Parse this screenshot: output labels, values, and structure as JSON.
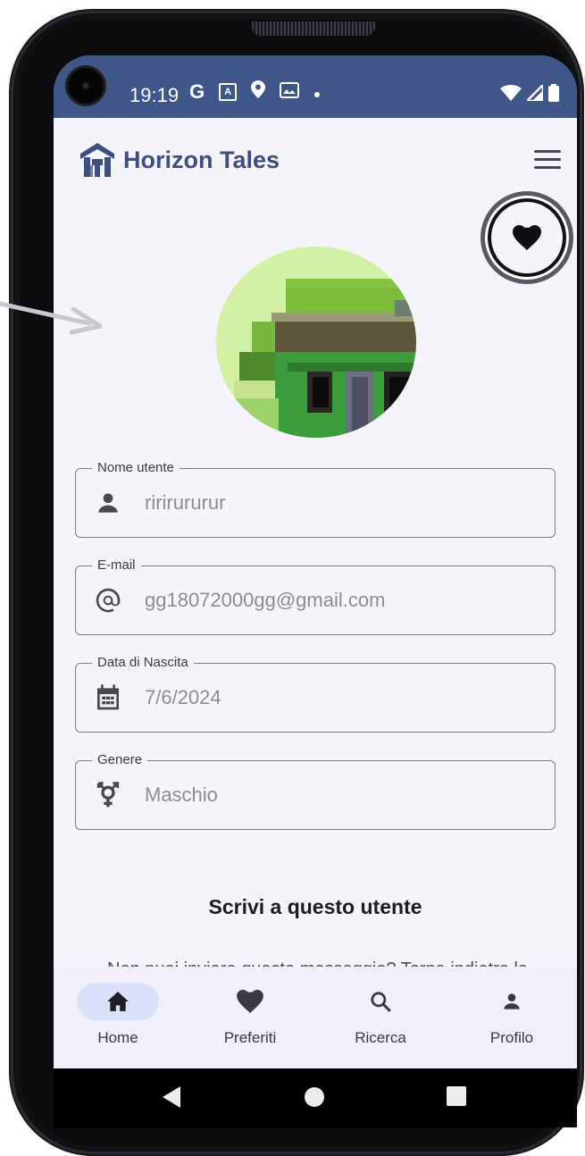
{
  "status_bar": {
    "time": "19:19",
    "icons": [
      "google-g-icon",
      "app-a-icon",
      "location-pin-icon",
      "gallery-icon",
      "dot-icon"
    ],
    "right_icons": [
      "wifi-icon",
      "signal-icon",
      "battery-icon"
    ],
    "color": "#3f5689"
  },
  "app_bar": {
    "title": "Horizon Tales",
    "title_color": "#3d4e80",
    "menu_icon": "hamburger-menu-icon"
  },
  "favorite_button": {
    "icon": "heart-icon"
  },
  "profile": {
    "fields": [
      {
        "label": "Nome utente",
        "value": "ririrururur",
        "icon": "person-icon"
      },
      {
        "label": "E-mail",
        "value": "gg18072000gg@gmail.com",
        "icon": "at-sign-icon"
      },
      {
        "label": "Data di Nascita",
        "value": "7/6/2024",
        "icon": "calendar-icon"
      },
      {
        "label": "Genere",
        "value": "Maschio",
        "icon": "gender-icon"
      }
    ],
    "section_title": "Scrivi a questo utente",
    "peek_text": "Non puoi inviare questo messaggio? Torna indietro la"
  },
  "bottom_nav": {
    "items": [
      {
        "label": "Home",
        "icon": "home-icon",
        "active": true
      },
      {
        "label": "Preferiti",
        "icon": "heart-icon",
        "active": false
      },
      {
        "label": "Ricerca",
        "icon": "search-icon",
        "active": false
      },
      {
        "label": "Profilo",
        "icon": "person-icon",
        "active": false
      }
    ],
    "active_color": "#dae2fb"
  },
  "system_nav": {
    "buttons": [
      "back-icon",
      "home-circle-icon",
      "recents-icon"
    ]
  }
}
